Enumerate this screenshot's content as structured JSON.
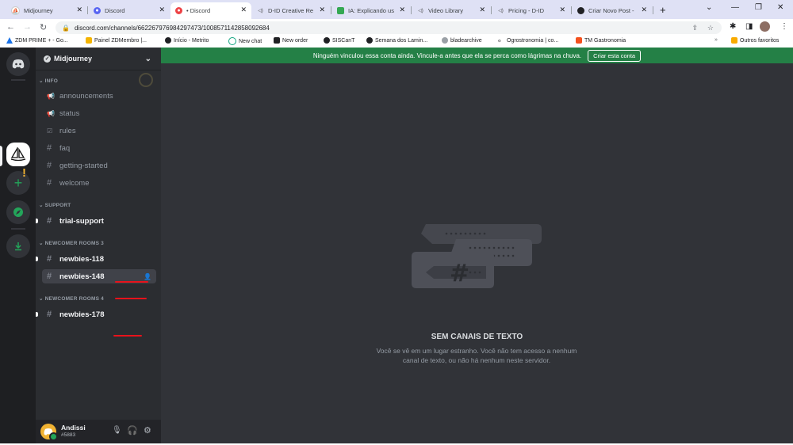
{
  "browser": {
    "tabs": [
      {
        "label": "Midjourney",
        "active": false
      },
      {
        "label": "Discord",
        "active": false
      },
      {
        "label": "• Discord",
        "active": true
      },
      {
        "label": "D-ID Creative Re",
        "active": false
      },
      {
        "label": "IA: Explicando us",
        "active": false
      },
      {
        "label": "Video Library",
        "active": false
      },
      {
        "label": "Pricing - D-ID",
        "active": false
      },
      {
        "label": "Criar Novo Post -",
        "active": false
      }
    ],
    "url": "discord.com/channels/662267976984297473/1008571142858092684",
    "bookmarks": [
      {
        "label": "ZDM PRIME + - Go...",
        "color": "#1a73e8"
      },
      {
        "label": "Painel ZDMembro |...",
        "color": "#f4b400"
      },
      {
        "label": "Início - Metrito",
        "color": "#202124"
      },
      {
        "label": "New chat",
        "color": "#10a37f"
      },
      {
        "label": "New order",
        "color": "#202124"
      },
      {
        "label": "SISCanT",
        "color": "#202124"
      },
      {
        "label": "Semana dos Lamin...",
        "color": "#202124"
      },
      {
        "label": "bladearchive",
        "color": "#9aa0a6"
      },
      {
        "label": "Ogrostronomia | co...",
        "color": "#202124"
      },
      {
        "label": "TM Gastronomia",
        "color": "#f4511e"
      }
    ],
    "other_bookmarks": "Outros favoritos"
  },
  "notice": {
    "text": "Ninguém vinculou essa conta ainda. Vincule-a antes que ela se perca como lágrimas na chuva.",
    "button": "Criar esta conta"
  },
  "server": {
    "name": "Midjourney",
    "categories": [
      {
        "name": "INFO",
        "channels": [
          {
            "name": "announcements",
            "icon": "megaphone-icon",
            "style": "read"
          },
          {
            "name": "status",
            "icon": "megaphone-icon",
            "style": "read"
          },
          {
            "name": "rules",
            "icon": "rules-icon",
            "style": "read"
          },
          {
            "name": "faq",
            "icon": "hash-icon",
            "style": "read"
          },
          {
            "name": "getting-started",
            "icon": "hash-icon",
            "style": "read"
          },
          {
            "name": "welcome",
            "icon": "hash-icon",
            "style": "read"
          }
        ]
      },
      {
        "name": "SUPPORT",
        "channels": [
          {
            "name": "trial-support",
            "icon": "hash-icon",
            "style": "unread"
          }
        ]
      },
      {
        "name": "NEWCOMER ROOMS 3",
        "channels": [
          {
            "name": "newbies-118",
            "icon": "hash-icon",
            "style": "unread"
          },
          {
            "name": "newbies-148",
            "icon": "hash-icon",
            "style": "selected"
          }
        ]
      },
      {
        "name": "NEWCOMER ROOMS 4",
        "channels": [
          {
            "name": "newbies-178",
            "icon": "hash-icon",
            "style": "unread"
          }
        ]
      }
    ]
  },
  "user": {
    "name": "Andissi",
    "tag": "#5883"
  },
  "empty_state": {
    "title": "SEM CANAIS DE TEXTO",
    "description": "Você se vê em um lugar estranho. Você não tem acesso a nenhum canal de texto, ou não há nenhum neste servidor."
  },
  "colors": {
    "accent_green": "#248046",
    "guild_bar": "#1e1f22",
    "sidebar": "#2b2d31",
    "main": "#313338"
  }
}
